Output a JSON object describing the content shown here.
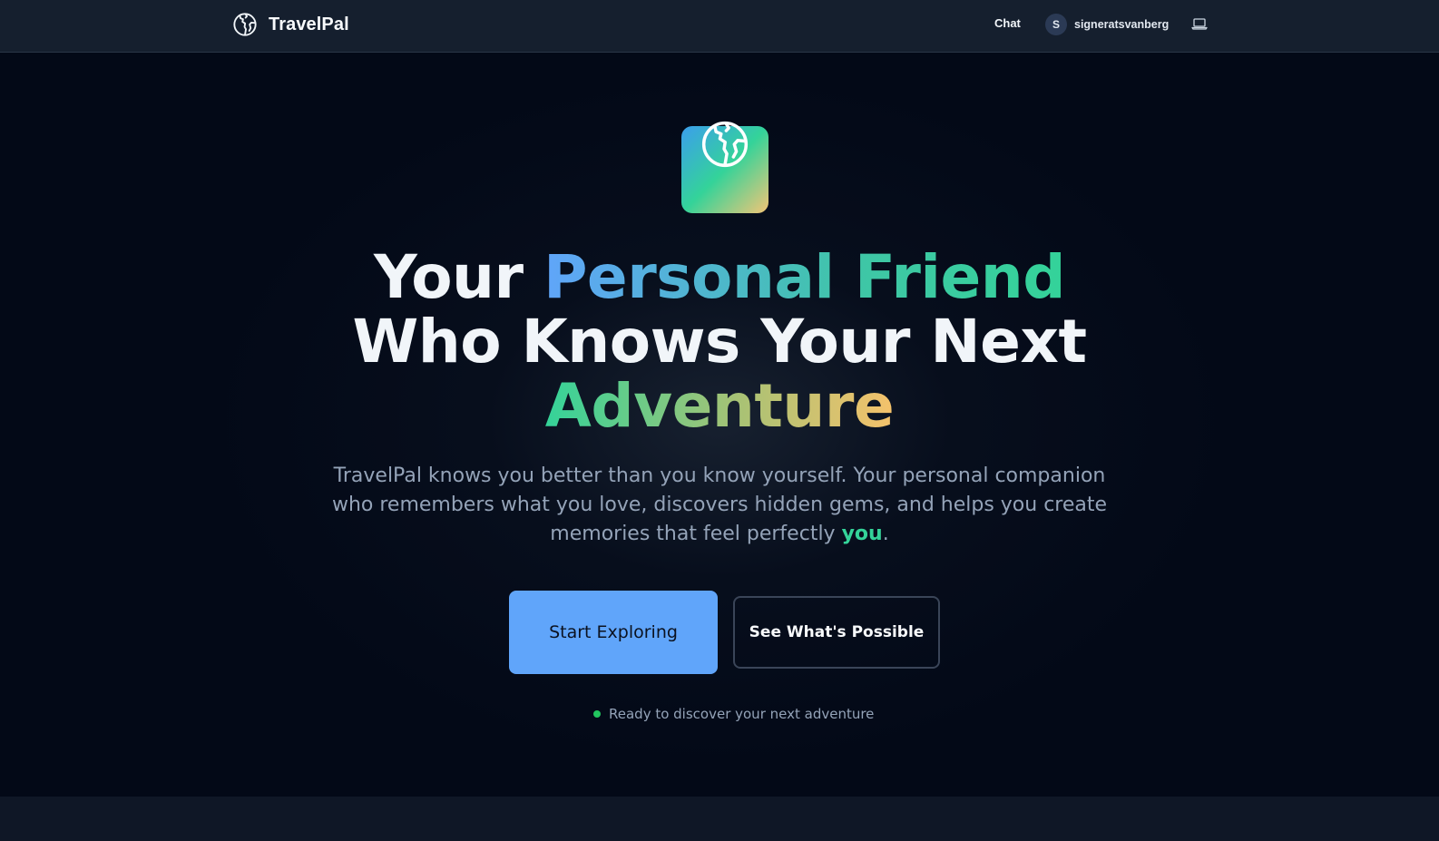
{
  "header": {
    "brand": "TravelPal",
    "nav_chat": "Chat",
    "user_initial": "S",
    "username": "signeratsvanberg"
  },
  "hero": {
    "headline_1": "Your ",
    "headline_highlight_1": "Personal Friend",
    "headline_2": "Who Knows Your Next",
    "headline_highlight_2": "Adventure",
    "subtitle_1": "TravelPal knows you better than you know yourself. Your personal companion who remembers what you love, discovers hidden gems, and helps you create memories that feel perfectly ",
    "subtitle_highlight": "you",
    "subtitle_end": ".",
    "primary_cta": "Start Exploring",
    "secondary_cta": "See What's Possible",
    "status": "Ready to discover your next adventure"
  },
  "icons": {
    "brand": "globe-icon",
    "app": "globe-icon",
    "theme_toggle": "laptop-icon",
    "status": "status-dot"
  },
  "colors": {
    "background": "#030917",
    "header_bg": "#151f2e",
    "accent_blue": "#60a5fa",
    "accent_green": "#34d399",
    "accent_gold": "#f5c26b",
    "muted_text": "#94a3b8",
    "status_green": "#22c55e"
  }
}
